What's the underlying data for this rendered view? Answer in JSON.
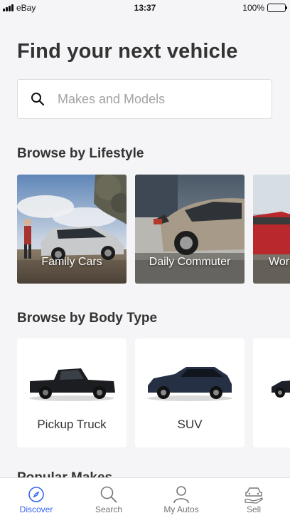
{
  "status_bar": {
    "carrier": "eBay",
    "time": "13:37",
    "battery": "100%"
  },
  "header": {
    "title": "Find your next vehicle"
  },
  "search": {
    "placeholder": "Makes and Models",
    "icon": "search-icon"
  },
  "lifestyle": {
    "heading": "Browse by Lifestyle",
    "items": [
      {
        "label": "Family Cars"
      },
      {
        "label": "Daily Commuter"
      },
      {
        "label": "Wor"
      }
    ]
  },
  "body_types": {
    "heading": "Browse by Body Type",
    "items": [
      {
        "label": "Pickup Truck"
      },
      {
        "label": "SUV"
      }
    ]
  },
  "next_section": {
    "heading": "Popular Makes"
  },
  "tabbar": {
    "items": [
      {
        "label": "Discover",
        "icon": "compass-icon",
        "active": true
      },
      {
        "label": "Search",
        "icon": "search-icon",
        "active": false
      },
      {
        "label": "My Autos",
        "icon": "user-icon",
        "active": false
      },
      {
        "label": "Sell",
        "icon": "sell-car-icon",
        "active": false
      }
    ]
  },
  "colors": {
    "accent": "#3665f3",
    "text": "#333333",
    "background": "#f5f5f7"
  }
}
